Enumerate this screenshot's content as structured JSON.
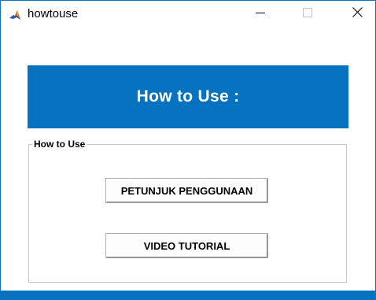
{
  "window": {
    "title": "howtouse",
    "icon": "matlab-icon",
    "controls": {
      "minimize": "minimize-icon",
      "maximize": "maximize-icon",
      "close": "close-icon"
    }
  },
  "banner": {
    "title": "How to Use :"
  },
  "group": {
    "label": "How to Use",
    "buttons": {
      "petunjuk": "PETUNJUK PENGGUNAAN",
      "video": "VIDEO TUTORIAL"
    }
  },
  "colors": {
    "accent": "#0772bf",
    "window_border": "#0a74c4",
    "background": "#ffffff"
  }
}
